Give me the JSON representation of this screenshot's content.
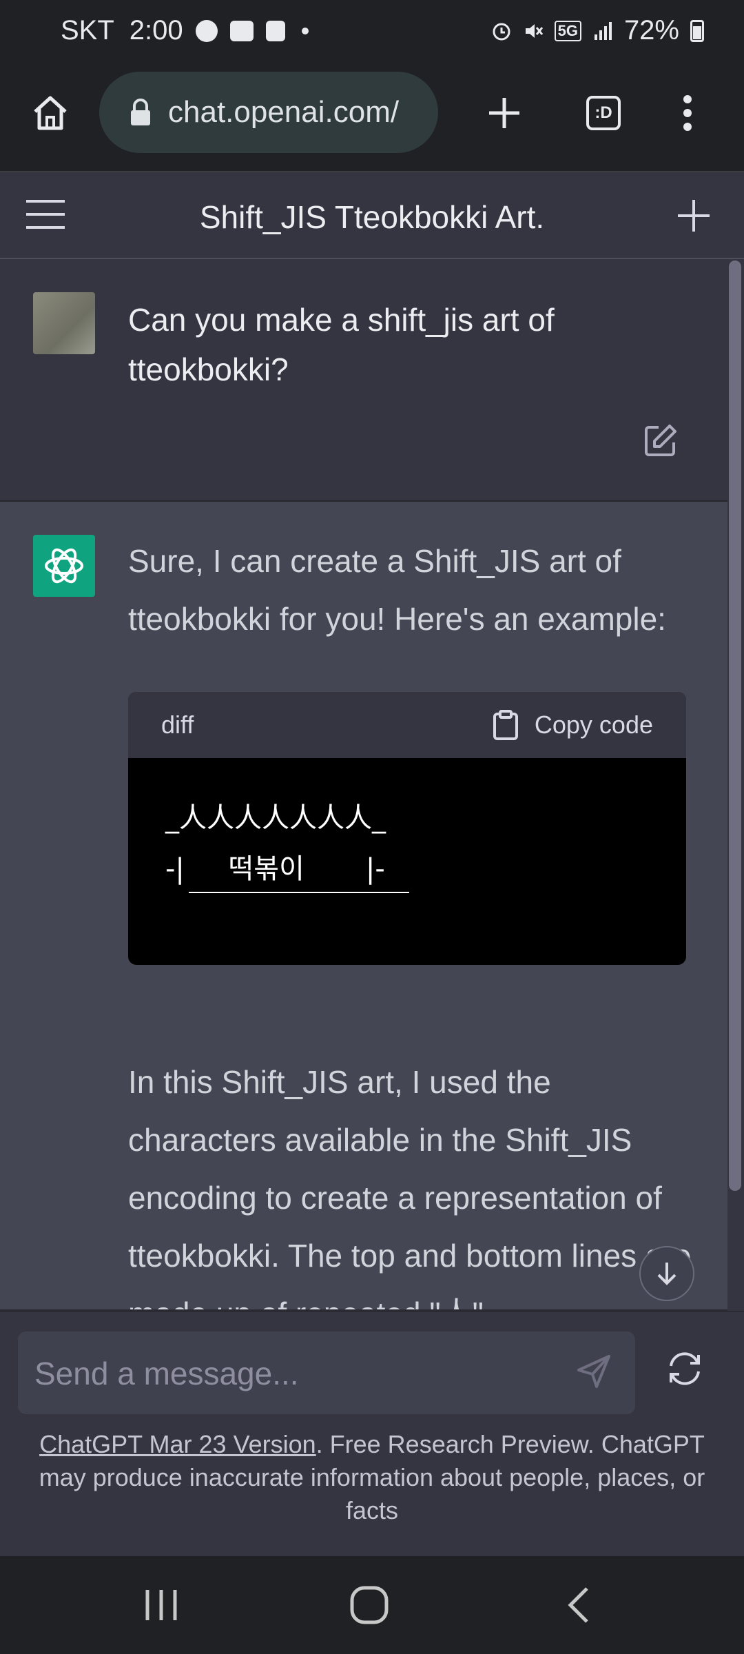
{
  "status_bar": {
    "carrier": "SKT",
    "time": "2:00",
    "left_icons": [
      "talk-icon",
      "gallery-icon",
      "clock-app-icon",
      "dot-icon"
    ],
    "right_icons": [
      "alarm-icon",
      "mute-icon",
      "5g-icon",
      "signal-icon",
      "battery-icon"
    ],
    "network": "5G",
    "battery": "72%"
  },
  "browser": {
    "url": "chat.openai.com/",
    "tab_count_label": ":D"
  },
  "chat": {
    "title": "Shift_JIS Tteokbokki Art."
  },
  "user_message": {
    "text": "Can you make a shift_jis art of tteokbokki?"
  },
  "assistant_message": {
    "intro": "Sure, I can create a Shift_JIS art of tteokbokki for you! Here's an example:",
    "code_language": "diff",
    "copy_label": "Copy code",
    "code_line1": "_人人人人人人人_",
    "code_line2": "-|     떡볶이       |-",
    "paragraph": "In this Shift_JIS art, I used the characters available in the Shift_JIS encoding to create a representation of tteokbokki. The top and bottom lines are made up of repeated \"人\""
  },
  "composer": {
    "placeholder": "Send a message..."
  },
  "disclaimer": {
    "version_link": "ChatGPT Mar 23 Version",
    "text": ". Free Research Preview. ChatGPT may produce inaccurate information about people, places, or facts"
  },
  "colors": {
    "background": "#343541",
    "assistant_bg": "#444654",
    "brand_green": "#10a37f",
    "browser_bar": "#202124"
  }
}
